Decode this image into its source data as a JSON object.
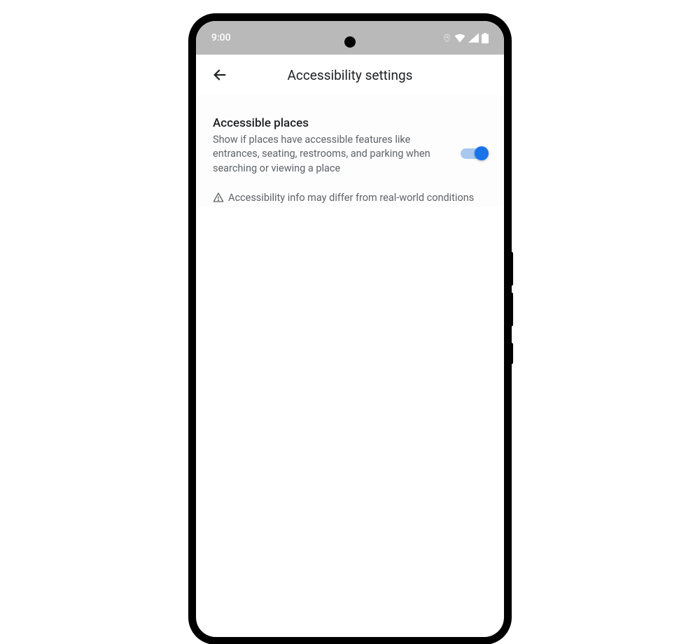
{
  "status": {
    "time": "9:00"
  },
  "header": {
    "title": "Accessibility settings"
  },
  "settings": {
    "accessible_places": {
      "title": "Accessible places",
      "description": "Show if places have accessible features like entrances, seating, restrooms, and parking when searching or viewing a place",
      "enabled": true
    },
    "disclaimer": "Accessibility info may differ from real-world conditions"
  }
}
